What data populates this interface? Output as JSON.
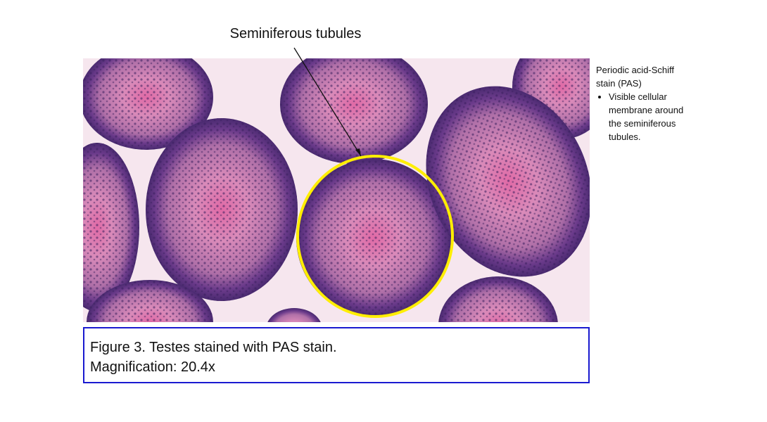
{
  "slide": {
    "arrow_label": "Seminiferous tubules",
    "side_note": {
      "heading": "Periodic acid-Schiff stain (PAS)",
      "bullets": [
        "Visible cellular membrane around the seminiferous tubules."
      ]
    },
    "caption": {
      "line1": "Figure 3. Testes stained with PAS stain.",
      "line2": "Magnification: 20.4x"
    },
    "colors": {
      "highlight_circle": "#ffee00",
      "caption_border": "#1a1ad0",
      "tissue_background": "#f6e6ee",
      "tubule_periphery": "#6a3a8a",
      "tubule_lumen": "#e48ab8"
    },
    "image": {
      "description_icon": "micrograph-image"
    }
  }
}
